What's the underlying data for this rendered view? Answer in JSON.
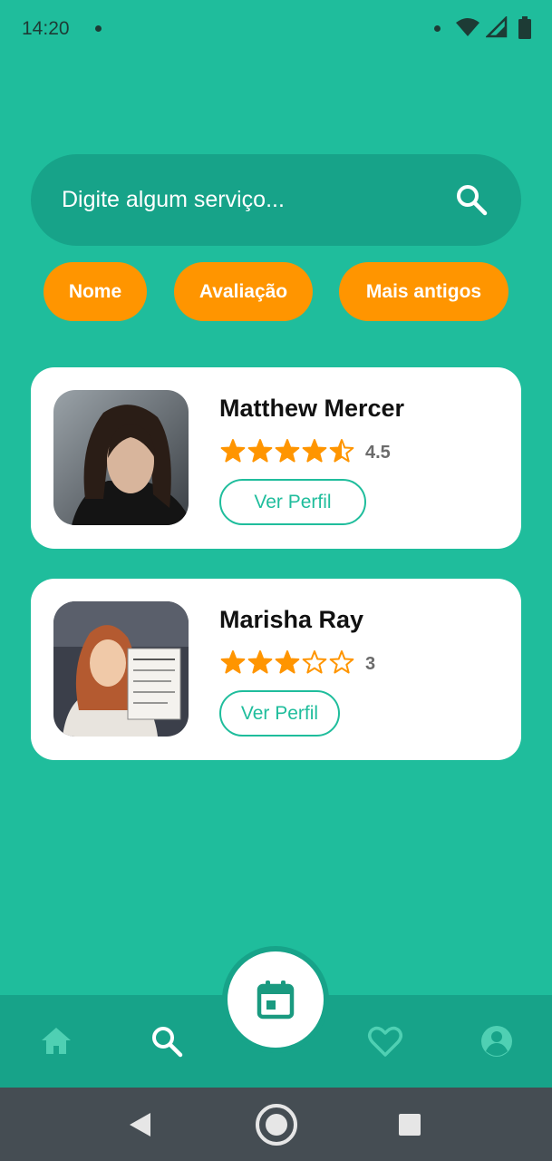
{
  "status_bar": {
    "time": "14:20"
  },
  "search": {
    "placeholder": "Digite algum serviço..."
  },
  "filters": [
    {
      "label": "Nome"
    },
    {
      "label": "Avaliação"
    },
    {
      "label": "Mais antigos"
    }
  ],
  "professionals": [
    {
      "name": "Matthew Mercer",
      "rating": "4.5",
      "rating_value": 4.5,
      "button_label": "Ver Perfil"
    },
    {
      "name": "Marisha Ray",
      "rating": "3",
      "rating_value": 3,
      "button_label": "Ver Perfil"
    }
  ],
  "colors": {
    "background": "#1fbd9c",
    "accent_dark": "#17a389",
    "chip": "#ff9500",
    "star": "#ff9500"
  },
  "bottom_nav": {
    "items": [
      {
        "icon": "home-icon"
      },
      {
        "icon": "search-icon",
        "active": true
      },
      {
        "icon": "calendar-icon",
        "center": true
      },
      {
        "icon": "heart-icon"
      },
      {
        "icon": "account-icon"
      }
    ]
  }
}
